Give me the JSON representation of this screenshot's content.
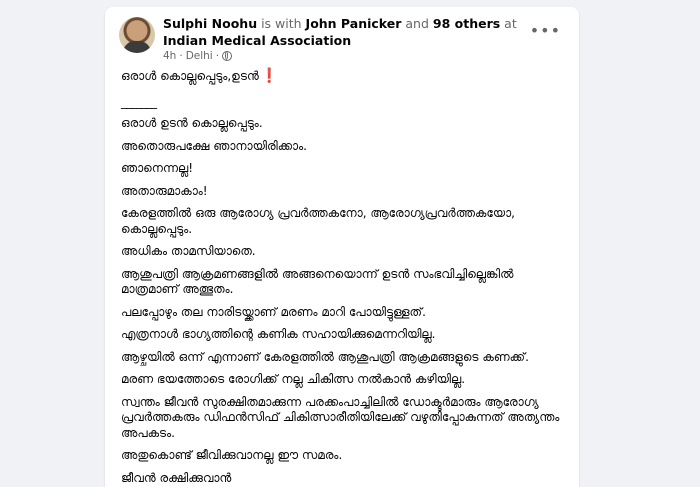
{
  "post": {
    "author": "Sulphi Noohu",
    "with_text": " is with ",
    "tagged_person": "John Panicker",
    "and_text": " and ",
    "others": "98 others",
    "at_text": " at ",
    "location": "Indian Medical Association",
    "time": "4h",
    "separator": "·",
    "place": "Delhi",
    "audience_separator": "·",
    "more_label": "•••",
    "title": "ഒരാൾ കൊല്ലപ്പെടും,ഉടൻ",
    "exclaim": "❗",
    "divider": "_______",
    "paragraphs": [
      "ഒരാൾ ഉടൻ കൊല്ലപ്പെടും.",
      "അതൊരുപക്ഷേ ഞാനായിരിക്കാം.",
      "ഞാനെന്നല്ല!",
      "അതാരുമാകാം!",
      "കേരളത്തിൽ ഒരു ആരോഗ്യ പ്രവർത്തകനോ, ആരോഗ്യപ്രവർത്തകയോ, കൊല്ലപ്പെടും.",
      "അധികം താമസിയാതെ.",
      "ആശുപത്രി ആക്രമണങ്ങളിൽ അങ്ങനെയൊന്ന് ഉടൻ സംഭവിച്ചില്ലെങ്കിൽ മാത്രമാണ് അത്ഭുതം.",
      "പലപ്പോഴും തല നാരിടയ്ക്കാണ് മരണം മാറി പോയിട്ടുള്ളത്.",
      "എത്രനാൾ ഭാഗ്യത്തിന്റെ കണിക സഹായിക്കുമെന്നറിയില്ല.",
      "ആഴ്ചയിൽ ഒന്ന് എന്നാണ് കേരളത്തിൽ ആശുപത്രി ആക്രമങ്ങളുടെ കണക്ക്.",
      "മരണ ഭയത്തോടെ രോഗിക്ക് നല്ല ചികിത്സ നൽകാൻ കഴിയില്ല.",
      "സ്വന്തം ജീവൻ സുരക്ഷിതമാക്കുന്ന പരക്കംപാച്ചിലിൽ ഡോക്ടർമാരും ആരോഗ്യ പ്രവർത്തകരും ഡിഫൻസിഫ് ചികിത്സാരീതിയിലേക്ക് വഴുതിപ്പോകുന്നത് അത്യന്തം അപകടം.",
      "അതുകൊണ്ട് ജീവിക്കുവാനല്ല ഈ സമരം.",
      "ജീവൻ രക്ഷിക്കുവാൻ"
    ]
  }
}
